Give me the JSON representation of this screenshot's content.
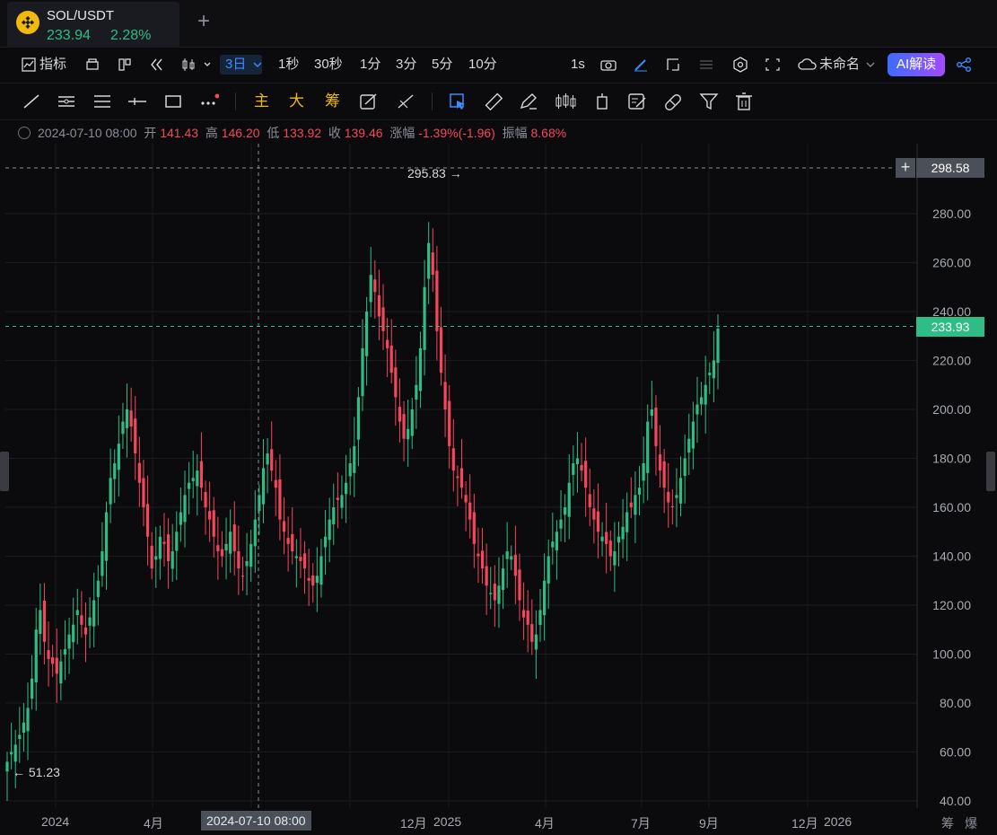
{
  "tab": {
    "symbol": "SOL/USDT",
    "price": "233.94",
    "change": "2.28%",
    "logo_icon": "binance-logo-icon"
  },
  "toolbar": {
    "indicators": "指标",
    "intervals": [
      "3日",
      "1秒",
      "30秒",
      "1分",
      "3分",
      "5分",
      "10分"
    ],
    "refresh_rate": "1s",
    "layout_name": "未命名",
    "ai_button": "AI解读"
  },
  "drawbar": {
    "main": "主",
    "big": "大",
    "chips": "筹"
  },
  "ohlc": {
    "date": "2024-07-10 08:00",
    "open_label": "开",
    "open": "141.43",
    "high_label": "高",
    "high": "146.20",
    "low_label": "低",
    "low": "133.92",
    "close_label": "收",
    "close": "139.46",
    "change_label": "涨幅",
    "change": "-1.39%(-1.96)",
    "amp_label": "振幅",
    "amp": "8.68%"
  },
  "chart_data": {
    "type": "candlestick",
    "y_ticks": [
      "280.00",
      "260.00",
      "240.00",
      "220.00",
      "200.00",
      "180.00",
      "160.00",
      "140.00",
      "120.00",
      "100.00",
      "80.00",
      "60.00",
      "40.00"
    ],
    "ylim": [
      40,
      300
    ],
    "x_ticks": [
      "2024",
      "4月",
      "12月",
      "2025",
      "4月",
      "7月",
      "9月",
      "12月",
      "2026"
    ],
    "crosshair_time": "2024-07-10 08:00",
    "crosshair_price": "298.58",
    "last_price": "233.93",
    "max_label": "295.83",
    "min_label": "51.23",
    "up_color": "#2ebd85",
    "down_color": "#f6465d",
    "closes": [
      56,
      60,
      63,
      67,
      72,
      78,
      90,
      110,
      118,
      105,
      98,
      96,
      92,
      97,
      102,
      108,
      112,
      118,
      112,
      108,
      115,
      122,
      130,
      142,
      158,
      172,
      178,
      186,
      195,
      200,
      193,
      182,
      170,
      160,
      148,
      135,
      140,
      148,
      145,
      138,
      142,
      150,
      158,
      165,
      170,
      172,
      175,
      168,
      160,
      155,
      148,
      142,
      140,
      145,
      150,
      142,
      135,
      132,
      138,
      145,
      155,
      165,
      176,
      182,
      175,
      168,
      155,
      150,
      145,
      142,
      140,
      138,
      135,
      130,
      128,
      132,
      140,
      148,
      155,
      160,
      163,
      165,
      170,
      178,
      185,
      205,
      225,
      240,
      255,
      248,
      238,
      232,
      225,
      215,
      205,
      195,
      188,
      192,
      200,
      210,
      225,
      250,
      268,
      255,
      232,
      215,
      200,
      185,
      175,
      172,
      168,
      162,
      155,
      145,
      140,
      135,
      128,
      125,
      122,
      128,
      135,
      142,
      140,
      132,
      122,
      115,
      112,
      105,
      108,
      118,
      130,
      140,
      146,
      150,
      155,
      160,
      170,
      178,
      180,
      175,
      168,
      160,
      155,
      150,
      148,
      145,
      140,
      142,
      148,
      152,
      158,
      160,
      165,
      168,
      178,
      195,
      200,
      185,
      175,
      168,
      162,
      160,
      165,
      172,
      180,
      188,
      195,
      202,
      205,
      210,
      215,
      220,
      233
    ]
  }
}
